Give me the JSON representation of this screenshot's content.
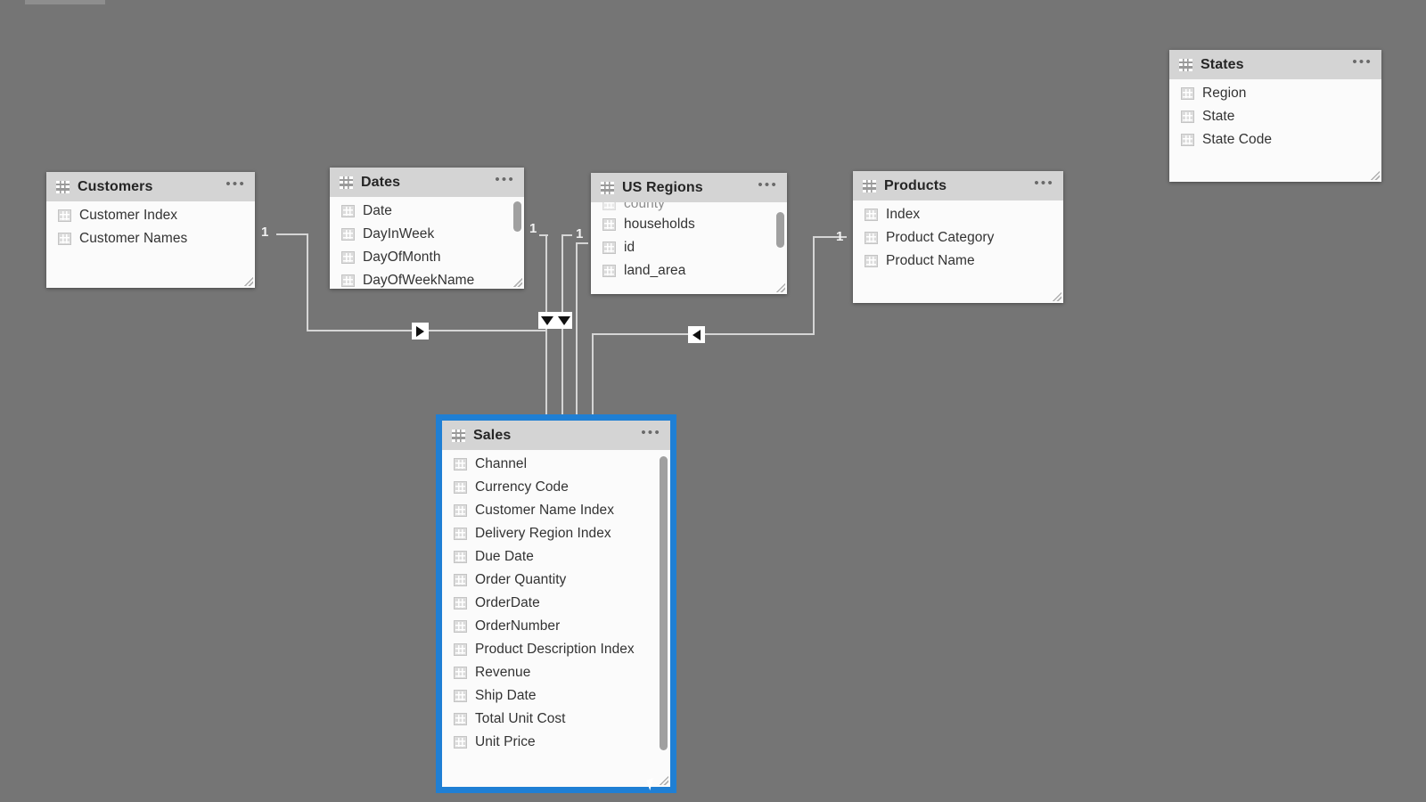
{
  "app": {
    "view_name": "Power BI Model View",
    "background_color": "#757575",
    "selection_color": "#1f7fd4",
    "card_header_color": "#d4d4d4",
    "card_body_color": "#fbfbfb"
  },
  "icons": {
    "table": "table-grid-icon",
    "field": "field-grid-icon",
    "more": "more-options-ellipsis"
  },
  "tables": [
    {
      "id": "customers",
      "name": "Customers",
      "more_label": "•••",
      "selected": false,
      "has_scrollbar": false,
      "fields": [
        "Customer Index",
        "Customer Names"
      ]
    },
    {
      "id": "dates",
      "name": "Dates",
      "more_label": "•••",
      "selected": false,
      "has_scrollbar": true,
      "fields": [
        "Date",
        "DayInWeek",
        "DayOfMonth",
        "DayOfWeekName"
      ]
    },
    {
      "id": "us-regions",
      "name": "US Regions",
      "more_label": "•••",
      "selected": false,
      "has_scrollbar": true,
      "fields": [
        "county",
        "households",
        "id",
        "land_area"
      ]
    },
    {
      "id": "products",
      "name": "Products",
      "more_label": "•••",
      "selected": false,
      "has_scrollbar": false,
      "fields": [
        "Index",
        "Product Category",
        "Product Name"
      ]
    },
    {
      "id": "states",
      "name": "States",
      "more_label": "•••",
      "selected": false,
      "has_scrollbar": false,
      "fields": [
        "Region",
        "State",
        "State Code"
      ]
    },
    {
      "id": "sales",
      "name": "Sales",
      "more_label": "•••",
      "selected": true,
      "has_scrollbar": true,
      "fields": [
        "Channel",
        "Currency Code",
        "Customer Name Index",
        "Delivery Region Index",
        "Due Date",
        "Order Quantity",
        "OrderDate",
        "OrderNumber",
        "Product Description Index",
        "Revenue",
        "Ship Date",
        "Total Unit Cost",
        "Unit Price"
      ]
    }
  ],
  "relationships": [
    {
      "id": "customers-sales",
      "from": "Customers",
      "to": "Sales",
      "from_cardinality": "1",
      "direction_marker": "arrow-right"
    },
    {
      "id": "dates-sales-1",
      "from": "Dates",
      "to": "Sales",
      "from_cardinality": "1",
      "direction_marker": "arrow-down"
    },
    {
      "id": "usregions-sales",
      "from": "US Regions",
      "to": "Sales",
      "from_cardinality": "1",
      "direction_marker": "arrow-down"
    },
    {
      "id": "products-sales",
      "from": "Products",
      "to": "Sales",
      "from_cardinality": "1",
      "direction_marker": "arrow-left"
    }
  ],
  "cardinality_labels": {
    "customers": "1",
    "dates": "1",
    "us_regions": "1",
    "products": "1"
  }
}
